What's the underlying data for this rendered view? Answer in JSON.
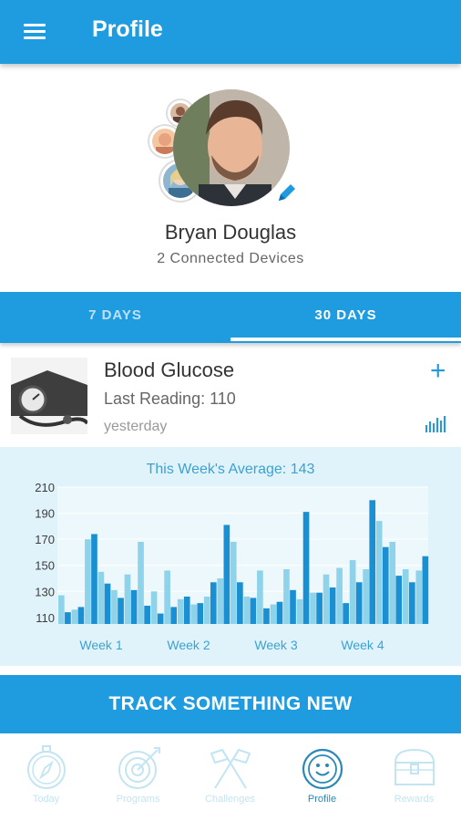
{
  "header": {
    "title": "Profile"
  },
  "profile": {
    "name": "Bryan Douglas",
    "subtitle": "2 Connected Devices"
  },
  "tabs": [
    {
      "label": "7 DAYS",
      "selected": false
    },
    {
      "label": "30 DAYS",
      "selected": true
    }
  ],
  "card": {
    "title": "Blood Glucose",
    "last_reading": "Last Reading: 110",
    "time": "yesterday",
    "add_label": "+"
  },
  "chart": {
    "caption": "This Week's Average: 143"
  },
  "chart_data": {
    "type": "bar",
    "title": "This Week's Average: 143",
    "xlabel": "",
    "ylabel": "",
    "ylim": [
      105,
      210
    ],
    "yticks": [
      110,
      130,
      150,
      170,
      190,
      210
    ],
    "week_labels": [
      "Week 1",
      "Week 2",
      "Week 3",
      "Week 4"
    ],
    "series": [
      {
        "values": [
          127,
          116,
          170,
          145,
          131,
          143,
          168,
          130,
          146,
          124,
          120,
          126,
          140,
          168,
          126,
          146,
          120,
          147,
          124,
          129,
          143,
          148,
          154,
          147,
          184,
          168,
          147,
          146
        ]
      },
      {
        "values": [
          114,
          118,
          174,
          136,
          125,
          131,
          119,
          113,
          118,
          126,
          121,
          137,
          181,
          137,
          125,
          117,
          122,
          131,
          191,
          129,
          133,
          121,
          137,
          200,
          164,
          142,
          137,
          157
        ]
      }
    ],
    "colors": {
      "light": "#8fd3ea",
      "dark": "#1a8fd2"
    }
  },
  "cta": {
    "label": "TRACK SOMETHING NEW"
  },
  "nav": [
    {
      "label": "Today",
      "icon": "compass-icon",
      "active": false
    },
    {
      "label": "Programs",
      "icon": "target-icon",
      "active": false
    },
    {
      "label": "Challenges",
      "icon": "flags-icon",
      "active": false
    },
    {
      "label": "Profile",
      "icon": "smiley-icon",
      "active": true
    },
    {
      "label": "Rewards",
      "icon": "chest-icon",
      "active": false
    }
  ],
  "colors": {
    "primary": "#1f9be0",
    "chart_bg": "#e1f3fa",
    "nav_inactive": "#c3e5f2",
    "nav_active": "#2a88b8"
  }
}
